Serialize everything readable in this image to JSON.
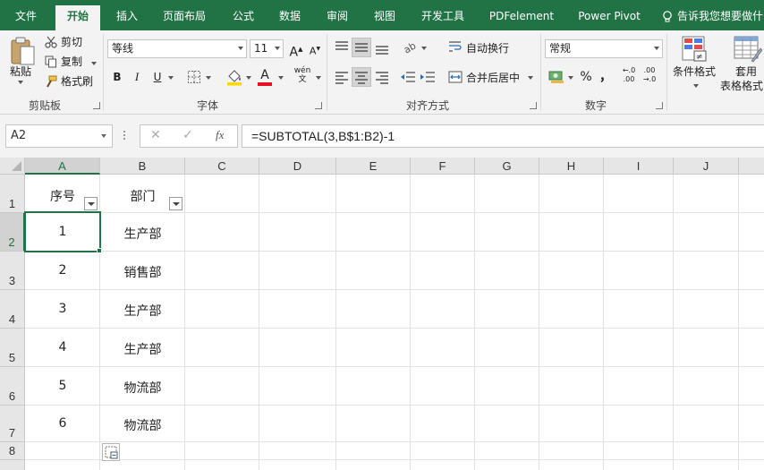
{
  "ribbon_tabs": [
    "文件",
    "开始",
    "插入",
    "页面布局",
    "公式",
    "数据",
    "审阅",
    "视图",
    "开发工具",
    "PDFelement",
    "Power Pivot"
  ],
  "tell_me": "告诉我您想要做什",
  "clipboard": {
    "paste": "粘贴",
    "cut": "剪切",
    "copy": "复制",
    "format_painter": "格式刷",
    "label": "剪贴板"
  },
  "font": {
    "name": "等线",
    "size": "11",
    "bold": "B",
    "italic": "I",
    "underline": "U",
    "grow": "A",
    "shrink": "A",
    "phonetic": "wén",
    "label": "字体"
  },
  "alignment": {
    "wrap_text": "自动换行",
    "merge_center": "合并后居中",
    "label": "对齐方式"
  },
  "number": {
    "format": "常规",
    "percent": "%",
    "comma": "，",
    "inc_decimal": ".00",
    "dec_decimal": ".0",
    "label": "数字"
  },
  "styles": {
    "conditional_formatting": "条件格式",
    "format_as_table_1": "套用",
    "format_as_table_2": "表格格式"
  },
  "formula_bar": {
    "name_box": "A2",
    "cancel": "✕",
    "enter": "✓",
    "fx": "fx",
    "formula": "=SUBTOTAL(3,B$1:B2)-1"
  },
  "columns": [
    "A",
    "B",
    "C",
    "D",
    "E",
    "F",
    "G",
    "H",
    "I",
    "J"
  ],
  "rows": [
    "1",
    "2",
    "3",
    "4",
    "5",
    "6",
    "7",
    "8"
  ],
  "header": {
    "a": "序号",
    "b": "部门"
  },
  "data_rows": [
    {
      "a": "1",
      "b": "生产部"
    },
    {
      "a": "2",
      "b": "销售部"
    },
    {
      "a": "3",
      "b": "生产部"
    },
    {
      "a": "4",
      "b": "生产部"
    },
    {
      "a": "5",
      "b": "物流部"
    },
    {
      "a": "6",
      "b": "物流部"
    }
  ],
  "colors": {
    "accent": "#217346",
    "font_color": "#e81123",
    "fill_color": "#ffd700"
  }
}
